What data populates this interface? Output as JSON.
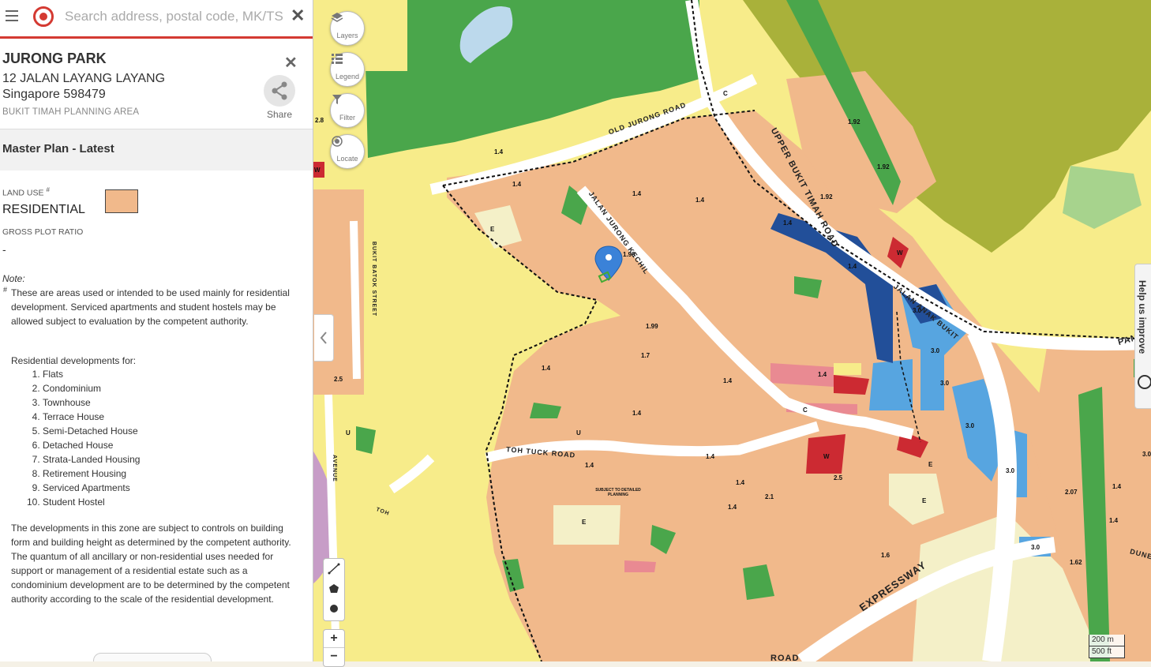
{
  "search": {
    "placeholder": "Search address, postal code, MK/TS Lot"
  },
  "place": {
    "name": "JURONG PARK",
    "address_line1": "12 JALAN LAYANG LAYANG",
    "address_line2": "Singapore 598479",
    "planning_area": "BUKIT TIMAH PLANNING AREA",
    "share_label": "Share"
  },
  "master_plan": {
    "title": "Master Plan - Latest",
    "land_use_label": "LAND USE",
    "land_use_sup": "#",
    "land_use_value": "RESIDENTIAL",
    "land_use_color": "#f1b98b",
    "gpr_label": "GROSS PLOT RATIO",
    "gpr_value": "-",
    "note_title": "Note:",
    "note_sup": "#",
    "note_p1": "These are areas used or intended to be used mainly for residential development. Serviced apartments and student hostels may be allowed subject to evaluation by the competent authority.",
    "dev_intro": "Residential developments for:",
    "dev_list": [
      "Flats",
      "Condominium",
      "Townhouse",
      "Terrace House",
      "Semi-Detached House",
      "Detached House",
      "Strata-Landed Housing",
      "Retirement Housing",
      "Serviced Apartments",
      "Student Hostel"
    ],
    "note_p2": "The developments in this zone are subject to controls on building form and building height as determined by the competent authority. The quantum of all ancillary or non-residential uses needed for support or management of a residential estate such as a condominium development are to be determined by the competent authority according to the scale of the residential development."
  },
  "map_controls": {
    "layers": "Layers",
    "legend": "Legend",
    "filter": "Filter",
    "locate": "Locate",
    "zoom_in": "+",
    "zoom_out": "−",
    "scale_m": "200 m",
    "scale_ft": "500 ft",
    "help": "Help us improve"
  },
  "map_labels": {
    "roads": {
      "old_jurong": "OLD JURONG ROAD",
      "upper_bukit_timah": "UPPER BUKIT TIMAH ROAD",
      "jalan_jurong_kechil": "JALAN JURONG KECHIL",
      "toh_tuck": "TOH TUCK ROAD",
      "expressway": "EXPRESSWAY",
      "jalan_anak_bukit": "JALAN ANAK BUKIT",
      "bukit_batok": "BUKIT BATOK STREET",
      "avenue": "AVENUE",
      "toh": "TOH",
      "road": "ROAD",
      "pan": "PAN",
      "dune": "DUNE"
    },
    "plot_ratios": [
      "1.4",
      "1.4",
      "1.4",
      "1.99",
      "1.99",
      "1.7",
      "1.4",
      "1.4",
      "1.4",
      "1.4",
      "1.4",
      "1.92",
      "1.92",
      "1.92",
      "1.4",
      "1.4",
      "3.0",
      "3.0",
      "3.0",
      "3.0",
      "3.0",
      "3.0",
      "2.5",
      "2.5",
      "2.8",
      "1.4",
      "1.6",
      "2.1",
      "1.4",
      "1.4",
      "2.07",
      "1.4",
      "1.4",
      "1.62",
      "3.0",
      "1.4"
    ],
    "zone_letters": [
      "E",
      "E",
      "E",
      "E",
      "W",
      "W",
      "W",
      "U",
      "U",
      "C",
      "C"
    ],
    "subject_to_planning": "SUBJECT TO DETAILED PLANNING"
  }
}
